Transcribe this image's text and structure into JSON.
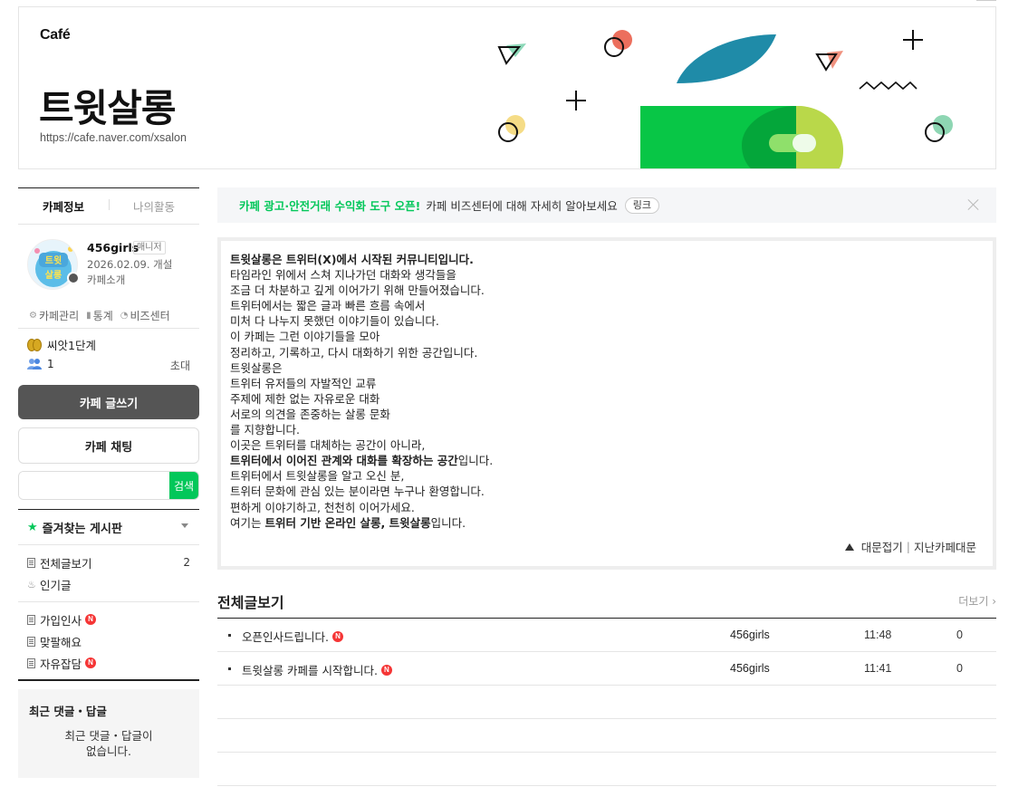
{
  "header": {
    "logo": "Café",
    "cafe_name": "트윗살롱",
    "cafe_url": "https://cafe.naver.com/xsalon"
  },
  "sidebar": {
    "tabs": [
      "카페정보",
      "나의활동"
    ],
    "manager_name": "456girls",
    "manager_badge": "매니저",
    "founded": "2026.02.09. 개설",
    "intro_link": "카페소개",
    "avatar_text": "트윗\n살롱",
    "mgmt_links": [
      "카페관리",
      "통계",
      "비즈센터"
    ],
    "level": "씨앗1단계",
    "member_count": "1",
    "invite": "초대",
    "write_button": "카페 글쓰기",
    "chat_button": "카페 채팅",
    "search_placeholder": "",
    "search_button": "검색",
    "favorites_title": "즐겨찾는 게시판",
    "boards_group1": [
      {
        "label": "전체글보기",
        "count": "2",
        "icon": "doc-icon",
        "new": false
      },
      {
        "label": "인기글",
        "count": "",
        "icon": "fire-icon",
        "new": false
      }
    ],
    "boards_group2": [
      {
        "label": "가입인사",
        "icon": "doc-icon",
        "new": true
      },
      {
        "label": "맞팔해요",
        "icon": "doc-icon",
        "new": false
      },
      {
        "label": "자유잡담",
        "icon": "doc-icon",
        "new": true
      }
    ],
    "new_badge": "N",
    "recent_title": "최근 댓글・답글",
    "recent_empty_line1": "최근 댓글・답글이",
    "recent_empty_line2": "없습니다."
  },
  "notice": {
    "accent": "카페 광고·안전거래 수익화 도구 오픈!",
    "text": "카페 비즈센터에 대해 자세히 알아보세요",
    "link": "링크"
  },
  "intro": {
    "lines": [
      {
        "b": "트윗살롱은 트위터(X)에서 시작된 커뮤니티입니다.",
        "t": ""
      },
      {
        "b": "",
        "t": "타임라인 위에서 스쳐 지나가던 대화와 생각들을"
      },
      {
        "b": "",
        "t": "조금 더 차분하고 깊게 이어가기 위해 만들어졌습니다."
      },
      {
        "b": "",
        "t": "트위터에서는 짧은 글과 빠른 흐름 속에서"
      },
      {
        "b": "",
        "t": "미처 다 나누지 못했던 이야기들이 있습니다."
      },
      {
        "b": "",
        "t": "이 카페는 그런 이야기들을 모아"
      },
      {
        "b": "",
        "t": "정리하고, 기록하고, 다시 대화하기 위한 공간입니다."
      },
      {
        "b": "",
        "t": "트윗살롱은"
      },
      {
        "b": "",
        "t": "트위터 유저들의 자발적인 교류"
      },
      {
        "b": "",
        "t": "주제에 제한 없는 자유로운 대화"
      },
      {
        "b": "",
        "t": "서로의 의견을 존중하는 살롱 문화"
      },
      {
        "b": "",
        "t": "를 지향합니다."
      },
      {
        "b": "",
        "t": "이곳은 트위터를 대체하는 공간이 아니라,"
      },
      {
        "b": "트위터에서 이어진 관계와 대화를 확장하는 공간",
        "t": "입니다."
      },
      {
        "b": "",
        "t": "트위터에서 트윗살롱을 알고 오신 분,"
      },
      {
        "b": "",
        "t": "트위터 문화에 관심 있는 분이라면 누구나 환영합니다."
      },
      {
        "b": "",
        "t": "편하게 이야기하고, 천천히 이어가세요."
      }
    ],
    "last_line_pre": "여기는 ",
    "last_line_bold": "트위터 기반 온라인 살롱, 트윗살롱",
    "last_line_post": "입니다.",
    "collapse": "대문접기",
    "separator": "|",
    "past_cover": "지난카페대문"
  },
  "list": {
    "title": "전체글보기",
    "more": "더보기",
    "rows": [
      {
        "subject": "오픈인사드립니다.",
        "author": "456girls",
        "time": "11:48",
        "views": "0"
      },
      {
        "subject": "트윗살롱 카페를 시작합니다.",
        "author": "456girls",
        "time": "11:41",
        "views": "0"
      }
    ]
  },
  "colors": {
    "naver_green": "#03c75a",
    "new_badge": "#f53535",
    "write_button": "#555555"
  }
}
